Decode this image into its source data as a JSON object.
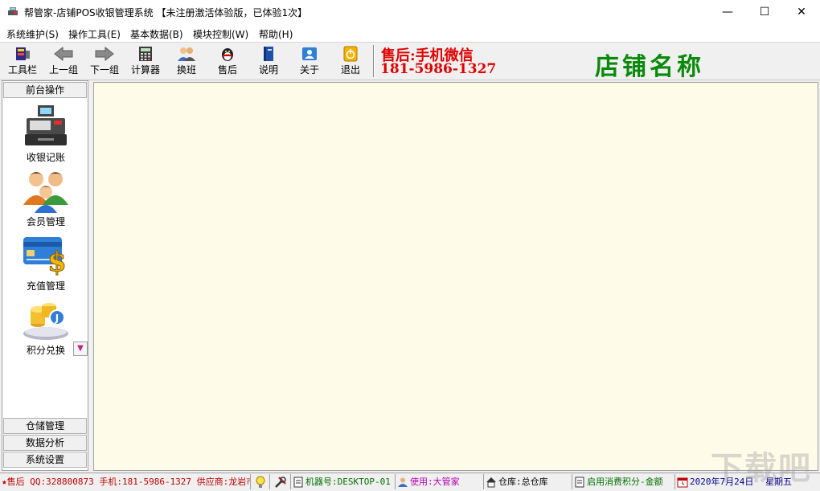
{
  "window": {
    "title": "帮管家-店铺POS收银管理系统 【未注册激活体验版，已体验1次】",
    "minimize": "—",
    "maximize": "☐",
    "close": "✕"
  },
  "menu": [
    "系统维护(S)",
    "操作工具(E)",
    "基本数据(B)",
    "模块控制(W)",
    "帮助(H)"
  ],
  "toolbar": {
    "buttons": [
      {
        "label": "工具栏",
        "icon": "toolbar-icon"
      },
      {
        "label": "上一组",
        "icon": "arrow-left-icon"
      },
      {
        "label": "下一组",
        "icon": "arrow-right-icon"
      },
      {
        "label": "计算器",
        "icon": "calculator-icon"
      },
      {
        "label": "换班",
        "icon": "users-icon"
      },
      {
        "label": "售后",
        "icon": "penguin-icon"
      },
      {
        "label": "说明",
        "icon": "book-icon"
      },
      {
        "label": "关于",
        "icon": "contact-card-icon"
      },
      {
        "label": "退出",
        "icon": "power-icon"
      }
    ],
    "hotline_line1": "售后:手机微信",
    "hotline_line2": "181-5986-1327",
    "shop_name": "店铺名称"
  },
  "sidebar": {
    "top_group": "前台操作",
    "items": [
      {
        "label": "收银记账",
        "icon": "cash-register-icon"
      },
      {
        "label": "会员管理",
        "icon": "members-icon"
      },
      {
        "label": "充值管理",
        "icon": "card-dollar-icon"
      },
      {
        "label": "积分兑换",
        "icon": "coins-icon"
      }
    ],
    "bottom_groups": [
      "仓储管理",
      "数据分析",
      "系统设置"
    ]
  },
  "statusbar": {
    "support": "★售后 QQ:328800873 手机:181-5986-1327 供应商:龙岩市",
    "machine": "机器号:DESKTOP-01",
    "user": "使用:大管家",
    "warehouse": "仓库:总仓库",
    "points": "启用消费积分-金额",
    "date": "2020年7月24日",
    "weekday": "星期五"
  },
  "watermark": "下载吧",
  "colors": {
    "hotline": "#e00000",
    "shop_name": "#0a8a0a",
    "workarea": "#fefbe8",
    "status_red": "#c00000",
    "status_green": "#007000",
    "status_magenta": "#b000b0",
    "status_blue": "#000090"
  }
}
